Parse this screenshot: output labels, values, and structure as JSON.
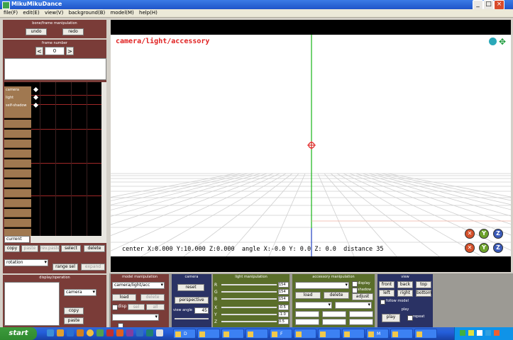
{
  "window": {
    "title": "MikuMikuDance"
  },
  "menu": [
    "file(F)",
    "edit(E)",
    "view(V)",
    "background(B)",
    "model(M)",
    "help(H)"
  ],
  "left_panel": {
    "header": "bone/frame manipulation",
    "undo_label": "undo",
    "redo_label": "redo",
    "frame_section_title": "frame number",
    "frame_value": "0",
    "row_labels": [
      "camera",
      "light",
      "self-shadow"
    ],
    "current_label": "current",
    "buttons_row1": [
      "copy",
      "paste",
      "rev.paste",
      "select",
      "delete"
    ],
    "interp_select": "rotation",
    "buttons_row2": [
      "range sel",
      "expand"
    ]
  },
  "bottom_left": {
    "header": "display/operation",
    "select_value": "camera",
    "btn1": "copy",
    "btn2": "paste"
  },
  "viewport": {
    "mode_label": "camera/light/accessory",
    "status": "center X:0.000 Y:10.000 Z:0.000  angle X:-0.0 Y: 0.0 Z: 0.0  distance 35"
  },
  "model_panel": {
    "header": "model manipulation",
    "select_value": "camera/light/acc",
    "load_label": "load",
    "delete_label": "delete",
    "cb1_label": "disp",
    "cb2_label": "sel",
    "cb3_label": "all"
  },
  "camera_panel": {
    "header": "camera",
    "reset_label": "reset",
    "perspective_label": "perspective",
    "viewangle_label": "view angle",
    "viewangle_value": "45"
  },
  "light_panel": {
    "header": "light manipulation",
    "rgb_labels": [
      "R",
      "G",
      "B"
    ],
    "rgb_values": [
      "154",
      "154",
      "154"
    ],
    "xyz_labels": [
      "X",
      "Y",
      "Z"
    ],
    "xyz_values": [
      "-0.5",
      "-1.0",
      "0.5"
    ]
  },
  "accessory_panel": {
    "header": "accessory manipulation",
    "display_label": "display",
    "shadow_label": "shadow",
    "load_label": "load",
    "delete_label": "delete",
    "adjust_label": "adjust"
  },
  "view_panel": {
    "header": "view",
    "buttons": [
      "front",
      "back",
      "top",
      "left",
      "right",
      "bottom"
    ],
    "follow_label": "follow model",
    "play_header": "play",
    "play_label": "play",
    "repeat_label": "repeat"
  },
  "taskbar": {
    "start_label": "start",
    "items": [
      "D",
      "",
      "",
      "",
      "F",
      "",
      "",
      "",
      "M"
    ]
  },
  "colors": {
    "accent_red": "#e02020",
    "axis_green": "#16b516",
    "grid": "#cfcfcf",
    "panel_brown": "#7a3c38",
    "panel_navy": "#2a3264",
    "panel_olive": "#5a6e2a"
  }
}
